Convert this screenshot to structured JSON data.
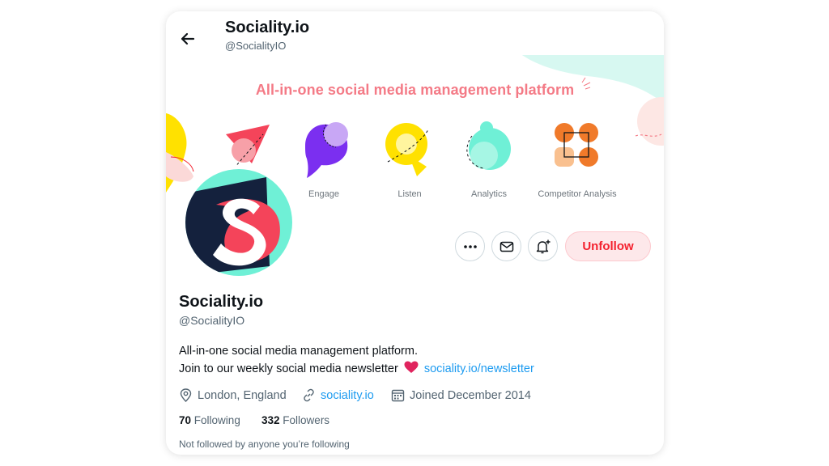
{
  "header": {
    "back_icon": "arrow-left-icon",
    "title": "Sociality.io",
    "handle": "@SocialityIO"
  },
  "banner": {
    "tagline": "All-in-one social media management platform",
    "features": [
      "Engage",
      "Listen",
      "Analytics",
      "Competitor Analysis"
    ]
  },
  "actions": {
    "more_icon": "more-horizontal-icon",
    "message_icon": "envelope-icon",
    "notify_icon": "bell-plus-icon",
    "unfollow_label": "Unfollow"
  },
  "profile": {
    "name": "Sociality.io",
    "handle": "@SocialityIO",
    "bio_line1": "All-in-one social media management platform.",
    "bio_line2": "Join to our weekly social media newsletter",
    "bio_link": "sociality.io/newsletter",
    "location": "London, England",
    "website": "sociality.io",
    "joined": "Joined December 2014",
    "following_count": "70",
    "following_label": "Following",
    "followers_count": "332",
    "followers_label": "Followers",
    "followed_by_note": "Not followed by anyone you’re following"
  },
  "colors": {
    "brand_red": "#f4212e",
    "link_blue": "#1d9bf0",
    "tagline_pink": "#f47a86",
    "logo_teal": "#6ff0d6",
    "logo_navy": "#14213d"
  }
}
